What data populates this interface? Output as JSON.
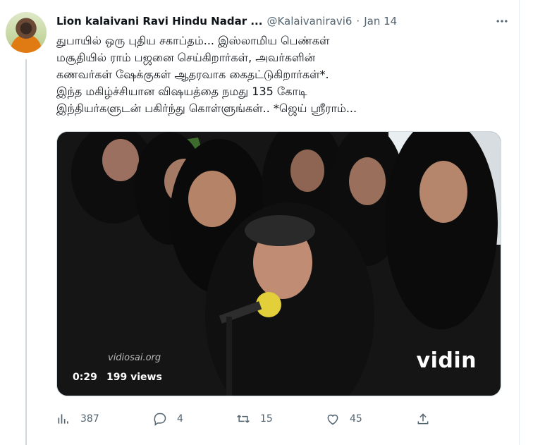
{
  "tweet": {
    "author_name": "Lion kalaivani Ravi Hindu Nadar ...",
    "author_handle": "@Kalaivaniravi6",
    "separator": "·",
    "date": "Jan 14",
    "text": "துபாயில் ஒரு புதிய சகாப்தம்... இஸ்லாமிய பெண்கள்\nமசூதியில் ராம் பஜனை செய்கிறார்கள், அவர்களின்\nகணவர்கள் ஷேக்குகள் ஆதரவாக கைதட்டுகிறார்கள்*.\n இந்த மகிழ்ச்சியான விஷயத்தை நமது 135 கோடி\nஇந்தியர்களுடன் பகிர்ந்து கொள்ளுங்கள்.. *ஜெய் ஸ்ரீராம்..."
  },
  "video": {
    "duration": "0:29",
    "views": "199 views",
    "brand": "vidin",
    "watermark": "vidiosai.org"
  },
  "actions": {
    "views_count": "387",
    "reply_count": "4",
    "retweet_count": "15",
    "like_count": "45"
  },
  "icons": [
    "more-icon",
    "views-icon",
    "reply-icon",
    "retweet-icon",
    "like-icon",
    "share-icon"
  ]
}
